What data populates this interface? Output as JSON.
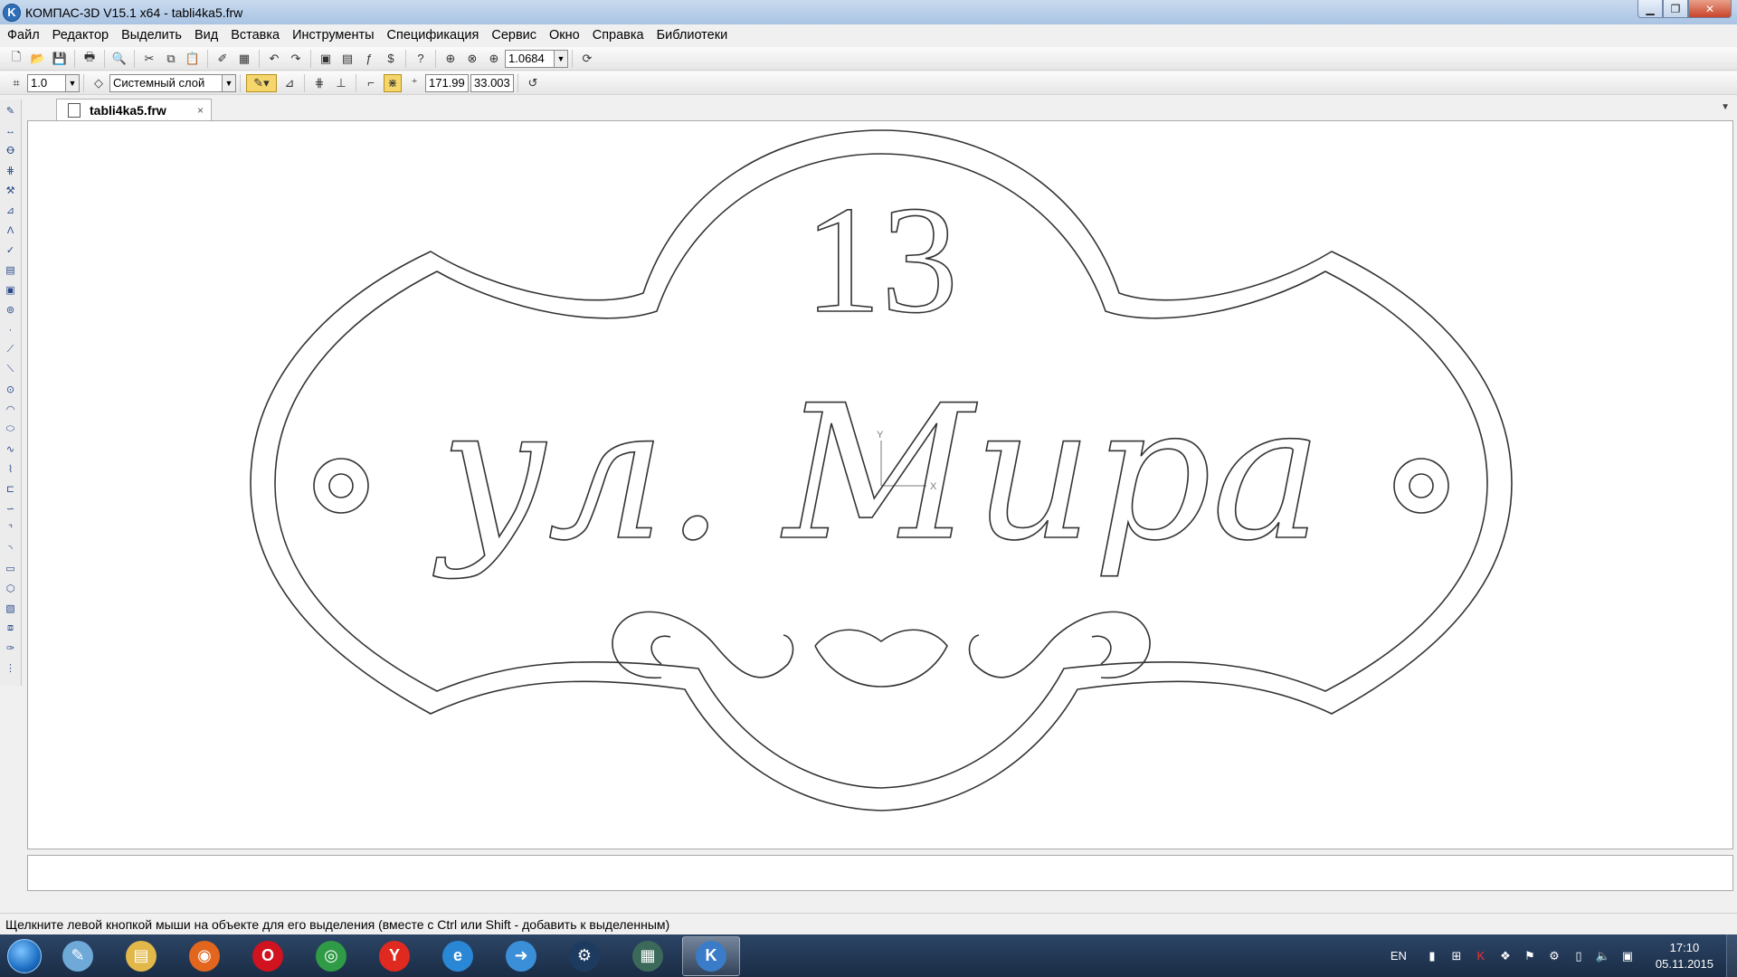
{
  "window": {
    "title": "КОМПАС-3D V15.1 x64 - tabli4ka5.frw",
    "app_icon_glyph": "K",
    "controls": {
      "minimize": "▁",
      "maximize": "❐",
      "close": "✕"
    }
  },
  "menu": [
    "Файл",
    "Редактор",
    "Выделить",
    "Вид",
    "Вставка",
    "Инструменты",
    "Спецификация",
    "Сервис",
    "Окно",
    "Справка",
    "Библиотеки"
  ],
  "toolbar1": {
    "zoom_value": "1.0684"
  },
  "toolbar2": {
    "step_value": "1.0",
    "layer_name": "Системный слой",
    "coord_x": "171.99",
    "coord_y": "33.003"
  },
  "document_tab": {
    "label": "tabli4ka5.frw",
    "close": "×"
  },
  "drawing": {
    "house_number": "13",
    "street_text": "ул. Мира",
    "axis_x": "X",
    "axis_y": "Y"
  },
  "status": {
    "hint": "Щелкните левой кнопкой мыши на объекте для его выделения (вместе с Ctrl или Shift - добавить к выделенным)"
  },
  "taskbar": {
    "apps": [
      {
        "name": "notepad",
        "glyph": "✎",
        "color": "#6ea9d8",
        "active": false
      },
      {
        "name": "explorer",
        "glyph": "▤",
        "color": "#e2b84a",
        "active": false
      },
      {
        "name": "firefox",
        "glyph": "◉",
        "color": "#e2661d",
        "active": false
      },
      {
        "name": "opera",
        "glyph": "O",
        "color": "#d1131f",
        "active": false
      },
      {
        "name": "chrome",
        "glyph": "◎",
        "color": "#2f9b46",
        "active": false
      },
      {
        "name": "yandex",
        "glyph": "Y",
        "color": "#e02a1f",
        "active": false
      },
      {
        "name": "internet-explorer",
        "glyph": "e",
        "color": "#2a87d6",
        "active": false
      },
      {
        "name": "skype",
        "glyph": "➜",
        "color": "#3a8fd8",
        "active": false
      },
      {
        "name": "steam",
        "glyph": "⚙",
        "color": "#1d3b5e",
        "active": false
      },
      {
        "name": "game-window",
        "glyph": "▦",
        "color": "#3b6a5a",
        "active": false
      },
      {
        "name": "kompas",
        "glyph": "K",
        "color": "#3a7cc7",
        "active": true
      }
    ],
    "language": "EN",
    "time": "17:10",
    "date": "05.11.2015"
  }
}
